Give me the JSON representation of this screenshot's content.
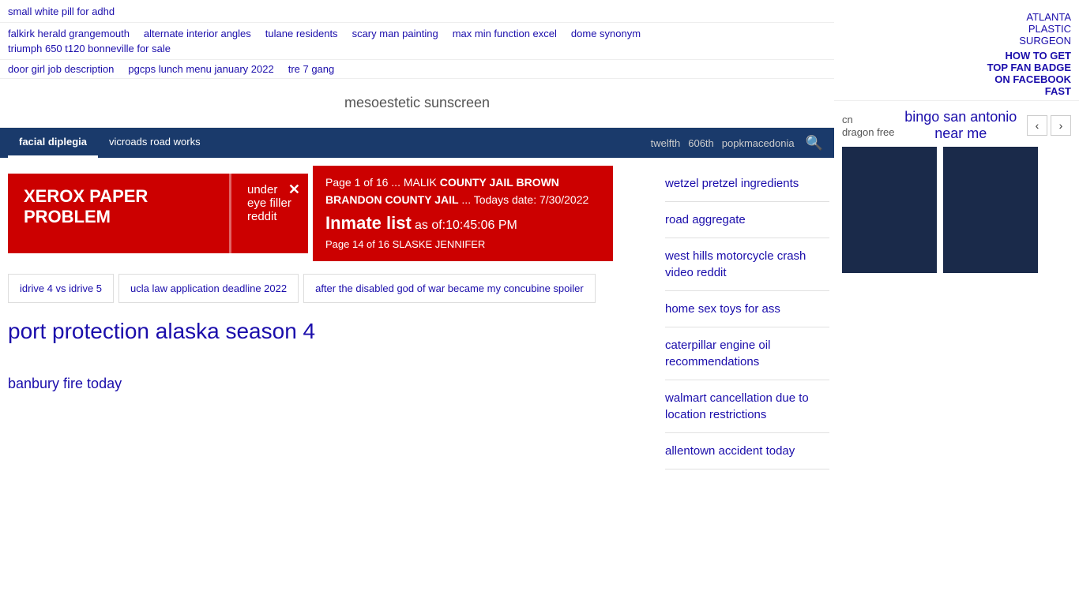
{
  "top": {
    "title": "small white pill for adhd"
  },
  "nav_row1": [
    {
      "label": "falkirk herald grangemouth"
    },
    {
      "label": "alternate interior angles"
    },
    {
      "label": "tulane residents"
    },
    {
      "label": "scary man painting"
    },
    {
      "label": "max min function excel"
    },
    {
      "label": "dome synonym"
    },
    {
      "label": "triumph 650 t120 bonneville for sale"
    }
  ],
  "nav_row2": [
    {
      "label": "door girl job description"
    },
    {
      "label": "pgcps lunch menu january 2022"
    },
    {
      "label": "tre 7 gang"
    }
  ],
  "right_top_links": [
    {
      "label": "ATLANTA"
    },
    {
      "label": "PLASTIC"
    },
    {
      "label": "SURGEON"
    },
    {
      "label": "HOW TO GET"
    },
    {
      "label": "TOP FAN BADGE"
    },
    {
      "label": "ON FACEBOOK"
    },
    {
      "label": "FAST"
    }
  ],
  "blue_nav": {
    "items": [
      {
        "label": "facial diplegia",
        "active": true
      },
      {
        "label": "vicroads road works",
        "active": false
      }
    ],
    "right_items": [
      {
        "label": "twelfth"
      },
      {
        "label": "606th"
      },
      {
        "label": "popkmacedonia"
      }
    ]
  },
  "meso": {
    "text": "mesoestetic sunscreen"
  },
  "alert": {
    "left_text": "XEROX PAPER PROBLEM",
    "right_text": "under eye filler reddit"
  },
  "inmate_banner": {
    "page_info": "Page 1 of 16 ... MALIK COUNTY JAIL BROWN BRANDON COUNTY JAIL ... Todays date: 7/30/2022",
    "inmate_list": "Inmate list",
    "time_text": "as of:10:45:06 PM",
    "page14": "Page 14 of 16 SLASKE JENNIFER"
  },
  "tabs": [
    {
      "label": "idrive 4 vs idrive 5"
    },
    {
      "label": "ucla law application deadline 2022"
    },
    {
      "label": "after the disabled god of war became my concubine spoiler"
    }
  ],
  "port_protection": "port protection alaska season 4",
  "banbury": "banbury fire today",
  "sidebar_links": [
    {
      "label": "wetzel pretzel ingredients"
    },
    {
      "label": "road aggregate"
    },
    {
      "label": "west hills motorcycle crash video reddit"
    },
    {
      "label": "home sex toys for ass"
    },
    {
      "label": "caterpillar engine oil recommendations"
    },
    {
      "label": "walmart cancellation due to location restrictions"
    },
    {
      "label": "allentown accident today"
    }
  ],
  "bingo": {
    "title": "bingo san antonio near me",
    "subtitle1": "cn",
    "subtitle2": "dragon free"
  }
}
